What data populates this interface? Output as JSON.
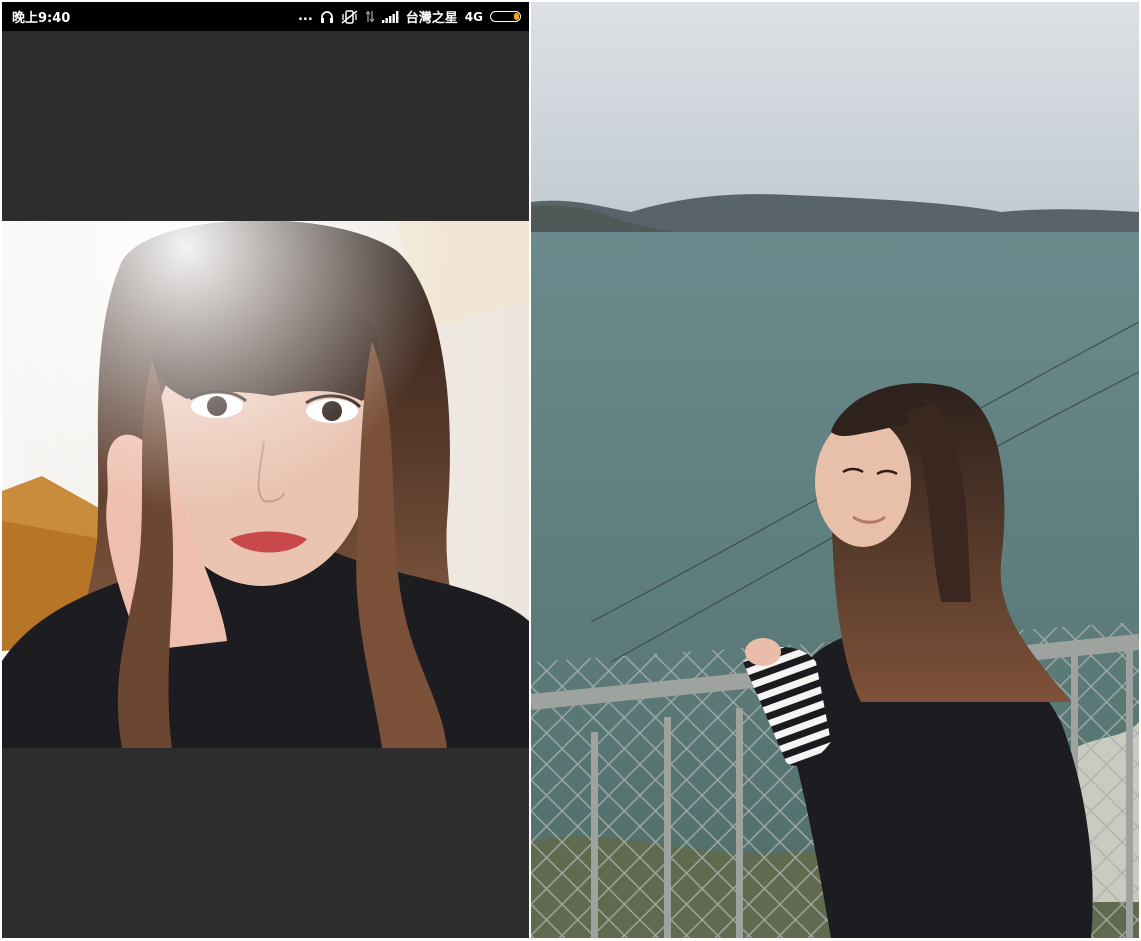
{
  "status_bar": {
    "time": "晚上9:40",
    "more": "...",
    "carrier": "台灣之星",
    "network": "4G",
    "battery_color": "#f5a623"
  },
  "icons": {
    "headphones": "headphones-icon",
    "mute": "vibrate-off-icon",
    "data": "data-transfer-icon",
    "signal": "signal-strength-icon",
    "battery": "battery-icon"
  },
  "colors": {
    "viewer_background": "#2d2d2d",
    "status_bar_background": "#000000",
    "sea": "#5d7a7a",
    "sky": "#c9d0d6"
  }
}
